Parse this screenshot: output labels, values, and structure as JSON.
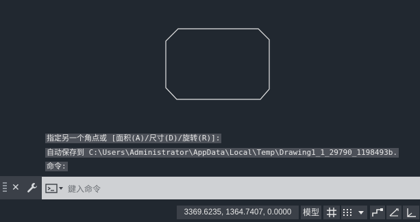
{
  "history": [
    "指定另一个角点或 [面积(A)/尺寸(D)/旋转(R)]:",
    "自动保存到 C:\\Users\\Administrator\\AppData\\Local\\Temp\\Drawing1_1_29790_1198493b.",
    "命令:"
  ],
  "command_line": {
    "placeholder": "鍵入命令"
  },
  "status": {
    "coordinates": "3369.6235, 1364.7407, 0.0000",
    "model_label": "模型"
  },
  "colors": {
    "background": "#212830",
    "shape_stroke": "#e6e6e6"
  }
}
